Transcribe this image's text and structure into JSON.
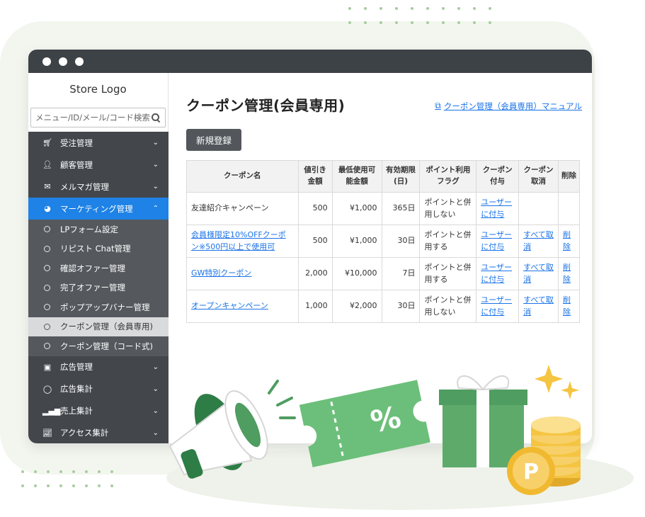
{
  "sidebar": {
    "logo": "Store Logo",
    "search_placeholder": "メニュー/ID/メール/コード検索",
    "items": [
      {
        "label": "受注管理",
        "icon": "cart-icon"
      },
      {
        "label": "顧客管理",
        "icon": "user-gear-icon"
      },
      {
        "label": "メルマガ管理",
        "icon": "mail-icon"
      },
      {
        "label": "マーケティング管理",
        "icon": "pie-chart-icon"
      }
    ],
    "subitems": [
      "LPフォーム設定",
      "リピスト Chat管理",
      "確認オファー管理",
      "完了オファー管理",
      "ポップアップバナー管理",
      "クーポン管理（会員専用)",
      "クーポン管理（コード式)"
    ],
    "items_after": [
      {
        "label": "広告管理",
        "icon": "ad-icon"
      },
      {
        "label": "広告集計",
        "icon": "circle-icon"
      },
      {
        "label": "売上集計",
        "icon": "bar-signal-icon"
      },
      {
        "label": "アクセス集計",
        "icon": "line-chart-icon"
      }
    ]
  },
  "main": {
    "title": "クーポン管理(会員専用)",
    "manual_link": "クーポン管理（会員専用）マニュアル",
    "new_button": "新規登録",
    "columns": [
      "クーポン名",
      "値引き金額",
      "最低使用可能金額",
      "有効期限(日)",
      "ポイント利用フラグ",
      "クーポン付与",
      "クーポン取消",
      "削除"
    ],
    "rows": [
      {
        "name": "友達紹介キャンペーン",
        "name_is_link": false,
        "discount": "500",
        "min": "¥1,000",
        "days": "365日",
        "point_flag": "ポイントと併用しない",
        "grant": "ユーザーに付与",
        "cancel": "",
        "delete": ""
      },
      {
        "name": "会員様限定10%OFFクーポン※500円以上で使用可",
        "name_is_link": true,
        "discount": "500",
        "min": "¥1,000",
        "days": "30日",
        "point_flag": "ポイントと併用する",
        "grant": "ユーザーに付与",
        "cancel": "すべて取消",
        "delete": "削除"
      },
      {
        "name": "GW特別クーポン",
        "name_is_link": true,
        "discount": "2,000",
        "min": "¥10,000",
        "days": "7日",
        "point_flag": "ポイントと併用する",
        "grant": "ユーザーに付与",
        "cancel": "すべて取消",
        "delete": "削除"
      },
      {
        "name": "オープンキャンペーン",
        "name_is_link": true,
        "discount": "1,000",
        "min": "¥2,000",
        "days": "30日",
        "point_flag": "ポイントと併用しない",
        "grant": "ユーザーに付与",
        "cancel": "すべて取消",
        "delete": "削除"
      }
    ]
  },
  "illustration": {
    "ticket_text": "%",
    "coin_text": "P"
  },
  "colors": {
    "accent": "#1e82e6",
    "sidebar": "#43474c",
    "titlebar": "#3d4247",
    "green": "#5eaa6b",
    "coin": "#f5c542"
  }
}
